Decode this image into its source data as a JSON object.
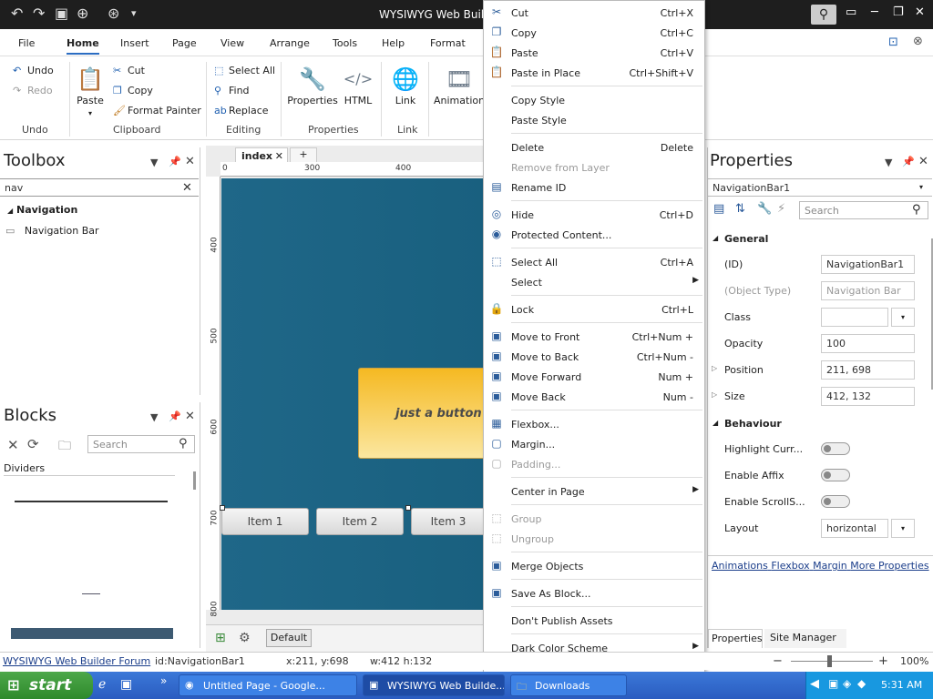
{
  "titlebar": {
    "title": "WYSIWYG Web Builder"
  },
  "ribbon_tabs": [
    "File",
    "Home",
    "Insert",
    "Page",
    "View",
    "Arrange",
    "Tools",
    "Help",
    "Format"
  ],
  "ribbon": {
    "undo": "Undo",
    "redo": "Redo",
    "paste": "Paste",
    "cut": "Cut",
    "copy": "Copy",
    "format_painter": "Format Painter",
    "select_all": "Select All",
    "find": "Find",
    "replace": "Replace",
    "properties": "Properties",
    "html": "HTML",
    "link": "Link",
    "animation": "Animation",
    "groups": {
      "undo": "Undo",
      "clipboard": "Clipboard",
      "editing": "Editing",
      "properties": "Properties",
      "link": "Link"
    }
  },
  "toolbox": {
    "title": "Toolbox",
    "search_value": "nav",
    "category": "Navigation",
    "item": "Navigation Bar"
  },
  "blocks": {
    "title": "Blocks",
    "search_placeholder": "Search",
    "category": "Dividers"
  },
  "doc_tab": {
    "name": "index",
    "add": "+"
  },
  "ruler": {
    "top": [
      "0",
      "300",
      "400"
    ],
    "left": [
      "400",
      "500",
      "600",
      "700",
      "800"
    ]
  },
  "canvas": {
    "button_text": "just a button yo",
    "nav_items": [
      "Item 1",
      "Item 2",
      "Item 3"
    ]
  },
  "bottom_toolbar": {
    "default_label": "Default"
  },
  "context_menu": [
    {
      "label": "Cut",
      "shortcut": "Ctrl+X",
      "icon": "cut-icon",
      "glyph": "✂"
    },
    {
      "label": "Copy",
      "shortcut": "Ctrl+C",
      "icon": "copy-icon",
      "glyph": "❐"
    },
    {
      "label": "Paste",
      "shortcut": "Ctrl+V",
      "icon": "paste-icon",
      "glyph": "📋"
    },
    {
      "label": "Paste in Place",
      "shortcut": "Ctrl+Shift+V",
      "icon": "paste-in-place-icon",
      "glyph": "📋"
    },
    {
      "sep": true
    },
    {
      "label": "Copy Style",
      "shortcut": ""
    },
    {
      "label": "Paste Style",
      "shortcut": ""
    },
    {
      "sep": true
    },
    {
      "label": "Delete",
      "shortcut": "Delete"
    },
    {
      "label": "Remove from Layer",
      "shortcut": "",
      "disabled": true
    },
    {
      "label": "Rename ID",
      "shortcut": "",
      "icon": "rename-icon",
      "glyph": "▤"
    },
    {
      "sep": true
    },
    {
      "label": "Hide",
      "shortcut": "Ctrl+D",
      "icon": "hide-icon",
      "glyph": "◎"
    },
    {
      "label": "Protected Content...",
      "shortcut": "",
      "icon": "protected-icon",
      "glyph": "◉"
    },
    {
      "sep": true
    },
    {
      "label": "Select All",
      "shortcut": "Ctrl+A",
      "icon": "select-all-icon",
      "glyph": "⬚"
    },
    {
      "label": "Select",
      "shortcut": "",
      "submenu": true
    },
    {
      "sep": true
    },
    {
      "label": "Lock",
      "shortcut": "Ctrl+L",
      "icon": "lock-icon",
      "glyph": "🔒"
    },
    {
      "sep": true
    },
    {
      "label": "Move to Front",
      "shortcut": "Ctrl+Num +",
      "icon": "move-front-icon",
      "glyph": "▣"
    },
    {
      "label": "Move to Back",
      "shortcut": "Ctrl+Num -",
      "icon": "move-back-icon",
      "glyph": "▣"
    },
    {
      "label": "Move Forward",
      "shortcut": "Num +",
      "icon": "move-forward-icon",
      "glyph": "▣"
    },
    {
      "label": "Move Back",
      "shortcut": "Num -",
      "icon": "move-back-one-icon",
      "glyph": "▣"
    },
    {
      "sep": true
    },
    {
      "label": "Flexbox...",
      "shortcut": "",
      "icon": "flexbox-icon",
      "glyph": "▦"
    },
    {
      "label": "Margin...",
      "shortcut": "",
      "icon": "margin-icon",
      "glyph": "▢"
    },
    {
      "label": "Padding...",
      "shortcut": "",
      "icon": "padding-icon",
      "glyph": "▢",
      "disabled": true
    },
    {
      "sep": true
    },
    {
      "label": "Center in Page",
      "shortcut": "",
      "submenu": true
    },
    {
      "sep": true
    },
    {
      "label": "Group",
      "shortcut": "",
      "icon": "group-icon",
      "glyph": "⬚",
      "disabled": true
    },
    {
      "label": "Ungroup",
      "shortcut": "",
      "icon": "ungroup-icon",
      "glyph": "⬚",
      "disabled": true
    },
    {
      "sep": true
    },
    {
      "label": "Merge Objects",
      "shortcut": "",
      "icon": "merge-icon",
      "glyph": "▣"
    },
    {
      "sep": true
    },
    {
      "label": "Save As Block...",
      "shortcut": "",
      "icon": "save-block-icon",
      "glyph": "▣"
    },
    {
      "sep": true
    },
    {
      "label": "Don't Publish Assets",
      "shortcut": ""
    },
    {
      "sep": true
    },
    {
      "label": "Dark Color Scheme",
      "shortcut": "",
      "submenu": true
    }
  ],
  "properties": {
    "title": "Properties",
    "object": "NavigationBar1",
    "search_placeholder": "Search",
    "general": "General",
    "rows": [
      {
        "key": "(ID)",
        "value": "NavigationBar1"
      },
      {
        "key": "(Object Type)",
        "value": "Navigation Bar",
        "disabled": true
      },
      {
        "key": "Class",
        "value": ""
      },
      {
        "key": "Opacity",
        "value": "100"
      },
      {
        "key": "Position",
        "value": "211, 698"
      },
      {
        "key": "Size",
        "value": "412, 132"
      }
    ],
    "behaviour": "Behaviour",
    "toggles": [
      "Highlight Curr...",
      "Enable Affix",
      "Enable ScrollS..."
    ],
    "layout_key": "Layout",
    "layout_value": "horizontal",
    "links": [
      "Animations",
      "Flexbox",
      "Margin",
      "More Properties"
    ],
    "tabs": [
      "Properties",
      "Site Manager"
    ]
  },
  "statusbar": {
    "forum": "WYSIWYG Web Builder Forum",
    "id": "id:NavigationBar1",
    "coords": "x:211, y:698",
    "size": "w:412 h:132",
    "zoom": "100%"
  },
  "taskbar": {
    "start": "start",
    "tasks": [
      "Untitled Page - Google...",
      "WYSIWYG Web Builde...",
      "Downloads"
    ],
    "clock": "5:31 AM"
  }
}
